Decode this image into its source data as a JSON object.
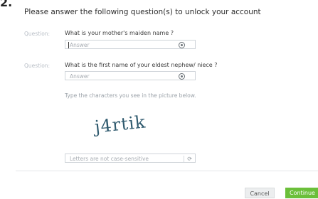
{
  "step_number": "2.",
  "heading": "Please answer the following question(s) to unlock your account",
  "questions": [
    {
      "label": "Question:",
      "text": "What is your mother's maiden name ?",
      "placeholder": "Answer"
    },
    {
      "label": "Question:",
      "text": "What is the first name of your eldest nephew/ niece ?",
      "placeholder": "Answer"
    }
  ],
  "captcha": {
    "instructions": "Type the characters you see in the picture below.",
    "image_text": "j4rtik",
    "placeholder": "Letters are not case-sensitive",
    "refresh_icon": "refresh-icon"
  },
  "buttons": {
    "cancel": "Cancel",
    "continue": "Continue"
  },
  "colors": {
    "accent": "#6bbf3a",
    "captcha_text": "#2f5a6e"
  }
}
